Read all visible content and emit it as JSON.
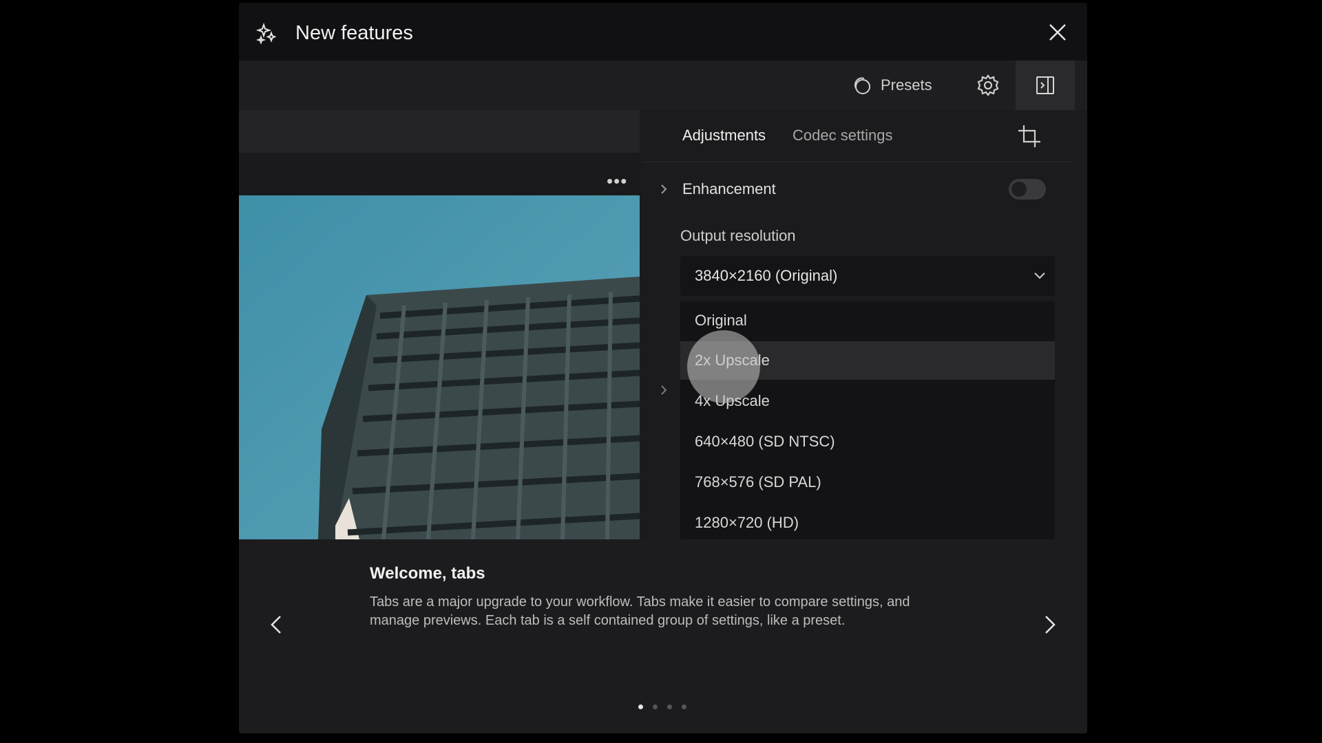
{
  "modal": {
    "title": "New features"
  },
  "toolbar": {
    "presets_label": "Presets"
  },
  "tabs": [
    {
      "label": "Adjustments",
      "active": true
    },
    {
      "label": "Codec settings",
      "active": false
    }
  ],
  "enhancement": {
    "label": "Enhancement",
    "enabled": false
  },
  "output_resolution": {
    "label": "Output resolution",
    "selected": "3840×2160 (Original)",
    "options": [
      "Original",
      "2x Upscale",
      "4x Upscale",
      "640×480 (SD NTSC)",
      "768×576 (SD PAL)",
      "1280×720 (HD)"
    ],
    "hovered_index": 1
  },
  "slide": {
    "title": "Welcome, tabs",
    "body": "Tabs are a major upgrade to your workflow. Tabs make it easier to compare settings, and manage previews. Each tab is a self contained group of settings, like a preset.",
    "current": 1,
    "total": 4
  },
  "colors": {
    "sky": "#4a94ad",
    "building": "#3c4a4c",
    "accent_text": "#f2f2f2"
  },
  "icons": [
    "sparkle-icon",
    "close-icon",
    "presets-icon",
    "gear-icon",
    "panel-toggle-icon",
    "crop-icon",
    "chevron-right-icon",
    "chevron-down-icon",
    "more-icon",
    "arrow-left-icon",
    "arrow-right-icon"
  ]
}
